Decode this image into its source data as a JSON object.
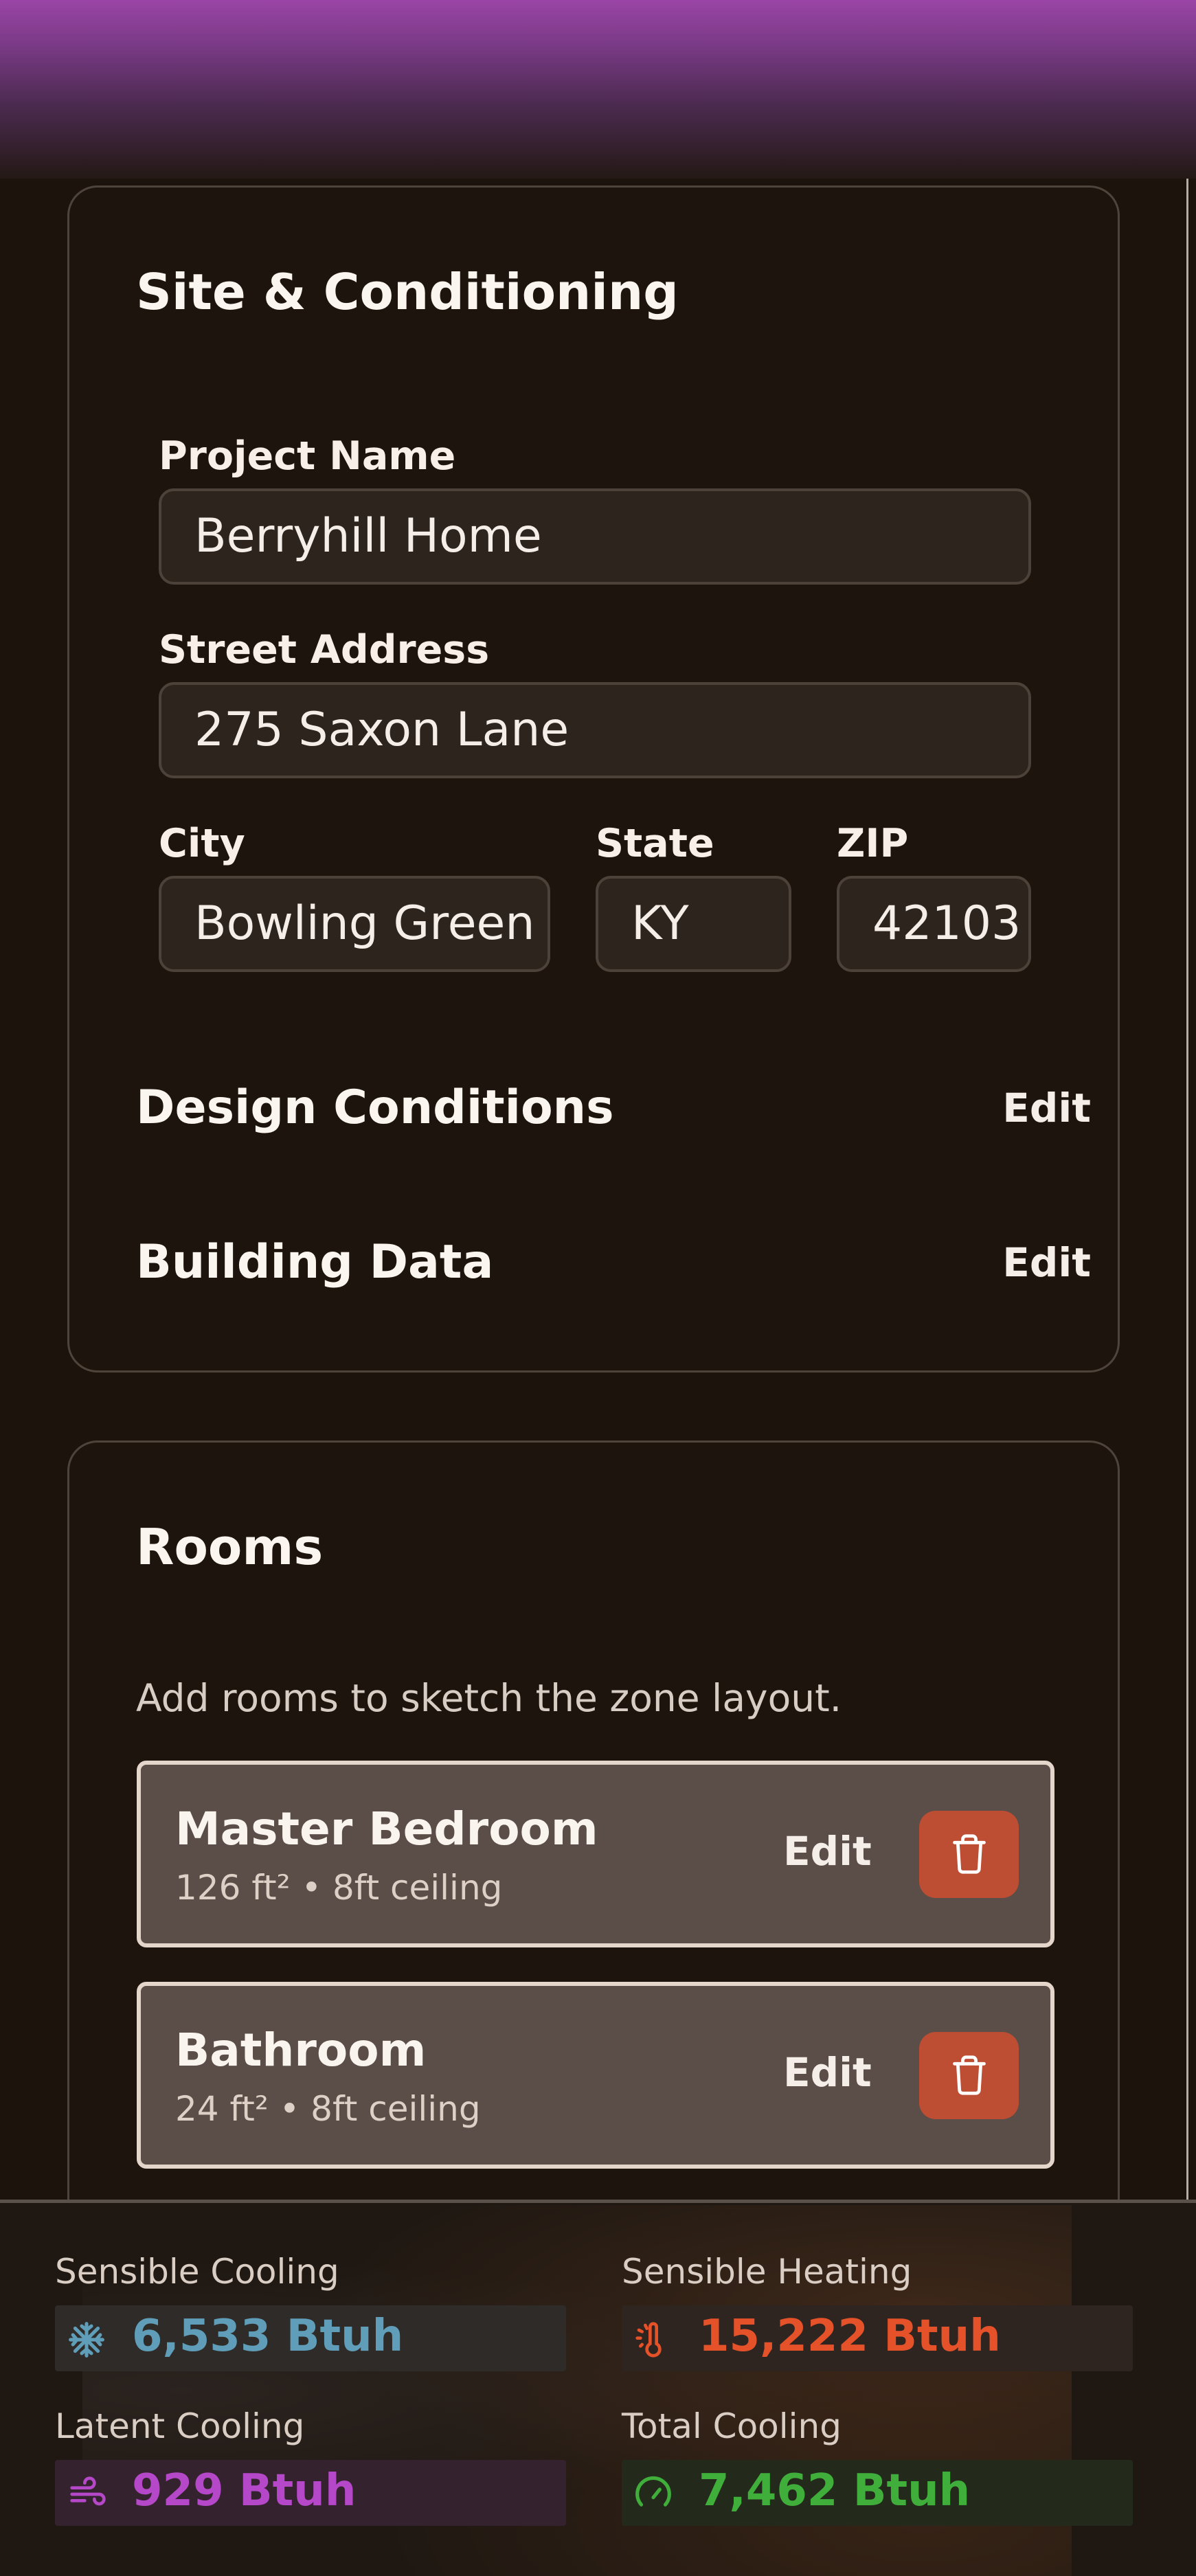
{
  "site": {
    "title": "Site & Conditioning",
    "project_name": {
      "label": "Project Name",
      "value": "Berryhill Home"
    },
    "street_address": {
      "label": "Street Address",
      "value": "275 Saxon Lane"
    },
    "city": {
      "label": "City",
      "value": "Bowling Green"
    },
    "state": {
      "label": "State",
      "value": "KY"
    },
    "zip": {
      "label": "ZIP",
      "value": "42103"
    },
    "sections": [
      {
        "title": "Design Conditions",
        "action": "Edit"
      },
      {
        "title": "Building Data",
        "action": "Edit"
      }
    ]
  },
  "rooms": {
    "title": "Rooms",
    "hint": "Add rooms to sketch the zone layout.",
    "items": [
      {
        "name": "Master Bedroom",
        "meta": "126 ft² • 8ft ceiling",
        "action": "Edit",
        "delete_icon": "trash-icon"
      },
      {
        "name": "Bathroom",
        "meta": "24 ft² • 8ft ceiling",
        "action": "Edit",
        "delete_icon": "trash-icon"
      }
    ]
  },
  "summary": {
    "sensible_cooling": {
      "label": "Sensible Cooling",
      "value": "6,533 Btuh",
      "icon": "snowflake-icon",
      "color": "#5f9db8"
    },
    "sensible_heating": {
      "label": "Sensible Heating",
      "value": "15,222 Btuh",
      "icon": "thermometer-sun-icon",
      "color": "#e5522a"
    },
    "latent_cooling": {
      "label": "Latent Cooling",
      "value": "929 Btuh",
      "icon": "wind-icon",
      "color": "#b548c8"
    },
    "total_cooling": {
      "label": "Total Cooling",
      "value": "7,462 Btuh",
      "icon": "gauge-icon",
      "color": "#3fae3a"
    }
  }
}
